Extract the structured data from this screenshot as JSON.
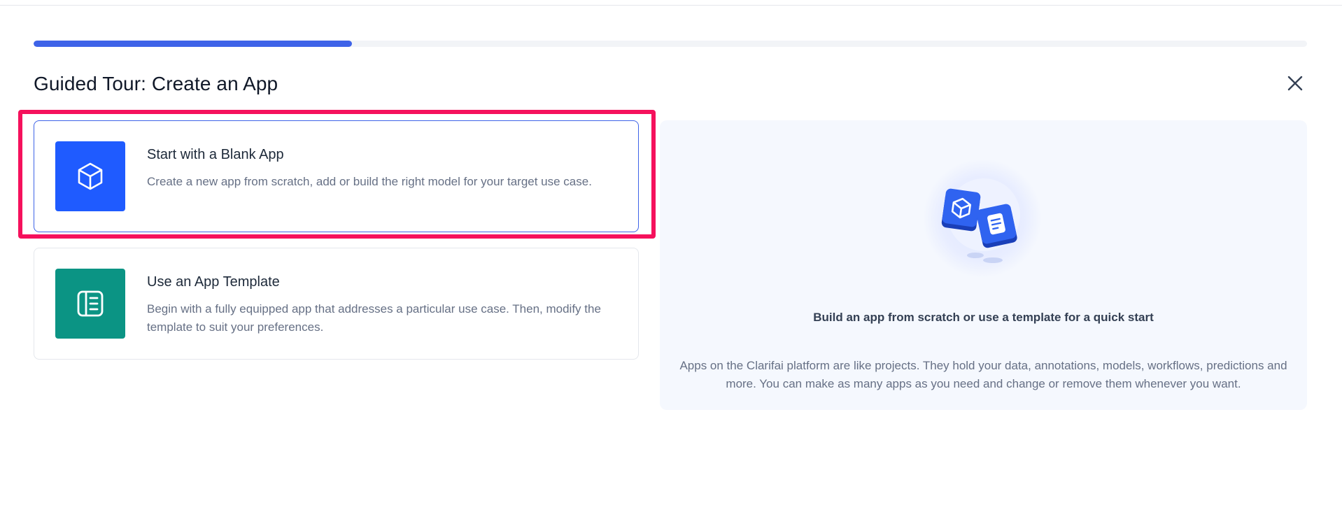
{
  "tour": {
    "title": "Guided Tour: Create an App",
    "progress": 0.25,
    "accent_color": "#3e63e8",
    "highlight_color": "#f5115c"
  },
  "options": [
    {
      "title": "Start with a Blank App",
      "description": "Create a new app from scratch, add or build the right model for your target use case.",
      "icon": "cube-icon",
      "icon_bg": "#1f5bff",
      "selected": true
    },
    {
      "title": "Use an App Template",
      "description": "Begin with a fully equipped app that addresses a particular use case. Then, modify the template to suit your preferences.",
      "icon": "template-icon",
      "icon_bg": "#0b9484",
      "selected": false
    }
  ],
  "info": {
    "heading": "Build an app from scratch or use a template for a quick start",
    "body": "Apps on the Clarifai platform are like projects. They hold your data, annotations, models, workflows, predictions and more. You can make as many apps as you need and change or remove them whenever you want."
  }
}
